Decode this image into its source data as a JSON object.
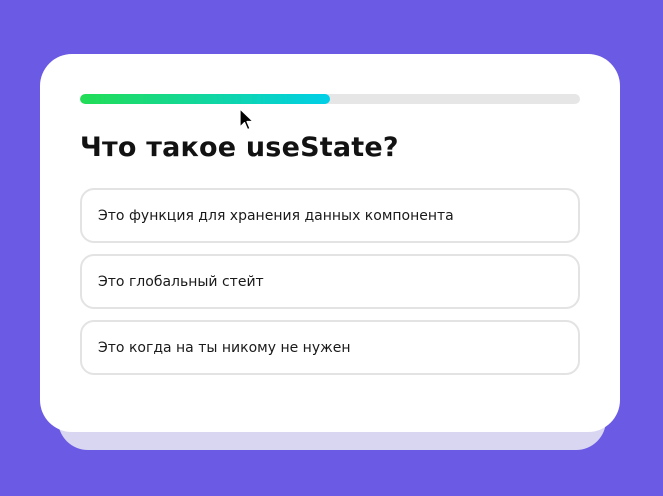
{
  "quiz": {
    "progress": 0.5,
    "question": "Что такое useState?",
    "answers": [
      "Это функция для хранения данных компонента",
      "Это глобальный стейт",
      "Это когда на ты никому не нужен"
    ]
  },
  "colors": {
    "background": "#6b5ae3",
    "progress_start": "#22dd55",
    "progress_end": "#00cfe8"
  },
  "icons": {
    "cursor": "arrow-cursor-icon"
  }
}
